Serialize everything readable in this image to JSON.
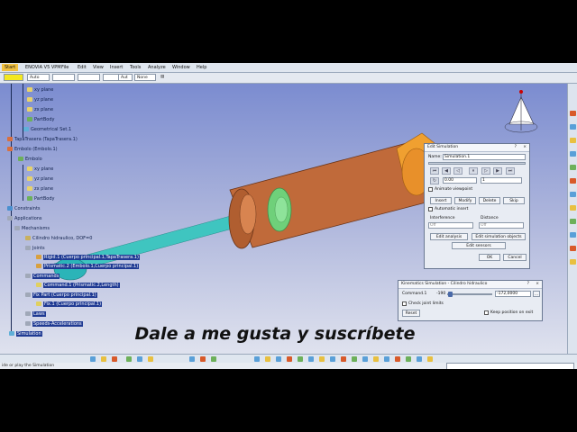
{
  "menubar": {
    "items": [
      "Start",
      "ENOVIA V5 VPM",
      "File",
      "Edit",
      "View",
      "Insert",
      "Tools",
      "Analyze",
      "Window",
      "Help"
    ]
  },
  "toolbar": {
    "auto1": "Auto",
    "auto2": "Aut",
    "none": "None"
  },
  "tree": {
    "items": [
      "xy plane",
      "yz plane",
      "zx plane",
      "PartBody",
      "Geometrical Set.1",
      "TapaTrasera (TapaTrasera.1)",
      "Embolo (Embolo.1)",
      "Embolo",
      "xy plane",
      "yz plane",
      "zx plane",
      "PartBody",
      "Constraints",
      "Applications",
      "Mechanisms",
      "Cilindro hidraulico, DOF=0",
      "Joints",
      "Rigid.1 (Cuerpo principal.1,TapaTrasera.1)",
      "Prismatic.2 (Embolo.1,Cuerpo principal.1)",
      "Commands",
      "Command.1 (Prismatic.2,Length)",
      "Fix Part (Cuerpo principal.1)",
      "Fix.1 (Cuerpo principal.1)",
      "Laws",
      "Speeds-Accelerations",
      "Simulation"
    ]
  },
  "edit_sim": {
    "title": "Edit Simulation",
    "name_label": "Name:",
    "name_value": "Simulation.1",
    "step_value": "0.00",
    "step_count": "1",
    "animate_viewpoint": "Animate viewpoint",
    "insert": "Insert",
    "modify": "Modify",
    "delete": "Delete",
    "skip": "Skip",
    "auto_insert": "Automatic insert",
    "interference_label": "Interference",
    "interference_value": "Off",
    "distance_label": "Distance",
    "distance_value": "Off",
    "edit_analysis": "Edit analysis",
    "edit_sim_objects": "Edit simulation objects",
    "edit_sensors": "Edit sensors",
    "ok": "OK",
    "cancel": "Cancel"
  },
  "kin_sim": {
    "title": "Kinematics Simulation - Cilindro hidraulico",
    "command_label": "Command.1",
    "min_value": "-190",
    "value": "-172,0000",
    "check_joint_limits": "Check joint limits",
    "reset": "Reset",
    "keep_position": "Keep position on exit"
  },
  "status": {
    "text": "ide or play the Simulation"
  },
  "caption": "Dale a me gusta y suscríbete",
  "colors": {
    "cylinder": "#c06a3a",
    "rod": "#3fc5c0",
    "piston": "#6fd07a"
  }
}
